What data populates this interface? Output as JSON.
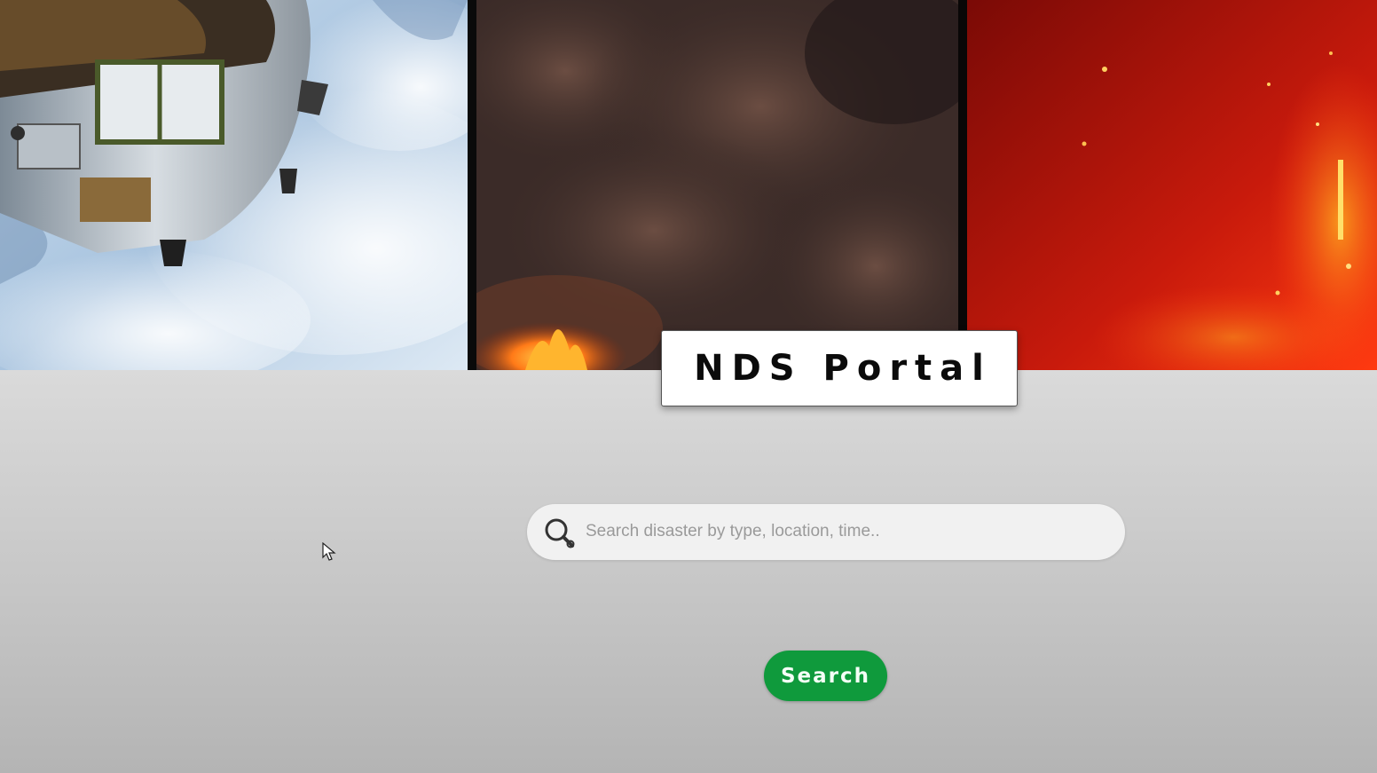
{
  "header": {
    "title": "NDS Portal"
  },
  "banner": {
    "images": [
      {
        "icon": "satellite-over-earth-image"
      },
      {
        "icon": "smoke-and-fire-image"
      },
      {
        "icon": "wildfire-embers-image"
      }
    ]
  },
  "search": {
    "placeholder": "Search disaster by type, location, time..",
    "value": "",
    "button_label": "Search"
  },
  "colors": {
    "accent": "#0f9a3c",
    "background": "#dcdcdc",
    "title_box": "#ffffff"
  }
}
